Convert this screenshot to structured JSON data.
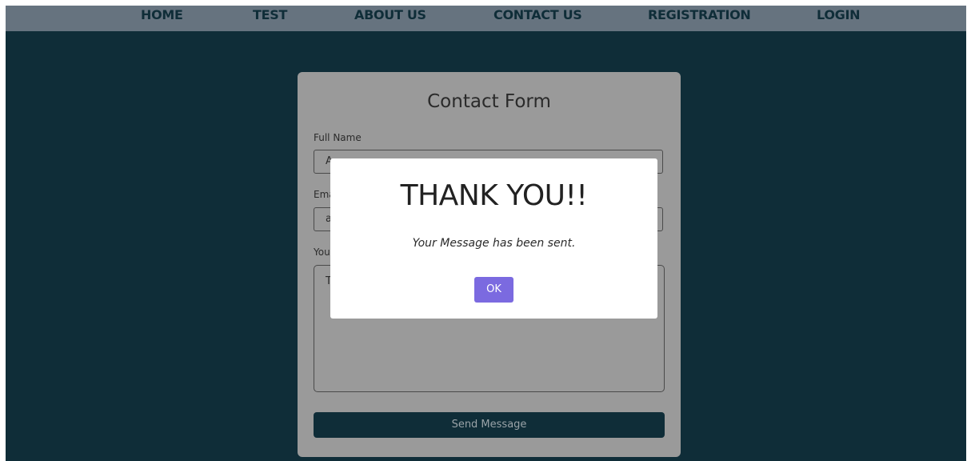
{
  "nav": {
    "items": [
      {
        "label": "HOME"
      },
      {
        "label": "TEST"
      },
      {
        "label": "ABOUT US"
      },
      {
        "label": "CONTACT US"
      },
      {
        "label": "REGISTRATION"
      },
      {
        "label": "LOGIN"
      }
    ]
  },
  "form": {
    "title": "Contact Form",
    "full_name_label": "Full Name",
    "full_name_value": "A",
    "email_label": "Ema",
    "email_value": "a",
    "message_label": "You",
    "message_value": "T",
    "send_label": "Send Message"
  },
  "modal": {
    "title": "THANK YOU!!",
    "message": "Your Message has been sent.",
    "ok_label": "OK"
  },
  "colors": {
    "background": "#0f2d38",
    "navbar": "#66737f",
    "card": "#9a9a9a",
    "ok_button": "#7b6ae0"
  }
}
